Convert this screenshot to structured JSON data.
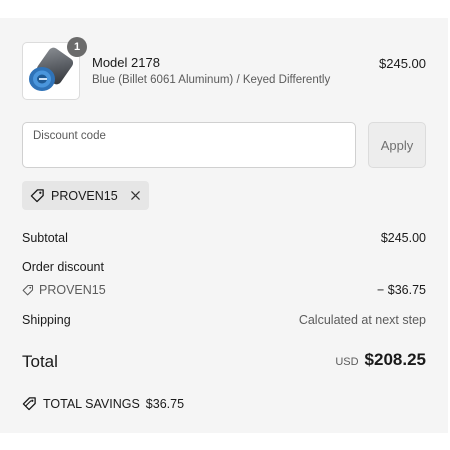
{
  "product": {
    "quantity": "1",
    "name": "Model 2178",
    "variant": "Blue (Billet 6061 Aluminum) / Keyed Differently",
    "price": "$245.00"
  },
  "discount": {
    "placeholder": "Discount code",
    "value": "",
    "apply_label": "Apply",
    "applied_code": "PROVEN15"
  },
  "summary": {
    "subtotal_label": "Subtotal",
    "subtotal_value": "$245.00",
    "order_discount_label": "Order discount",
    "discount_code": "PROVEN15",
    "discount_value": "− $36.75",
    "shipping_label": "Shipping",
    "shipping_value": "Calculated at next step",
    "total_label": "Total",
    "currency": "USD",
    "total_value": "$208.25",
    "savings_label": "TOTAL SAVINGS",
    "savings_value": "$36.75"
  },
  "colors": {
    "panel_bg": "#f5f5f5",
    "product_blue": "#3a7fc4",
    "badge_gray": "#6b6b6b"
  }
}
